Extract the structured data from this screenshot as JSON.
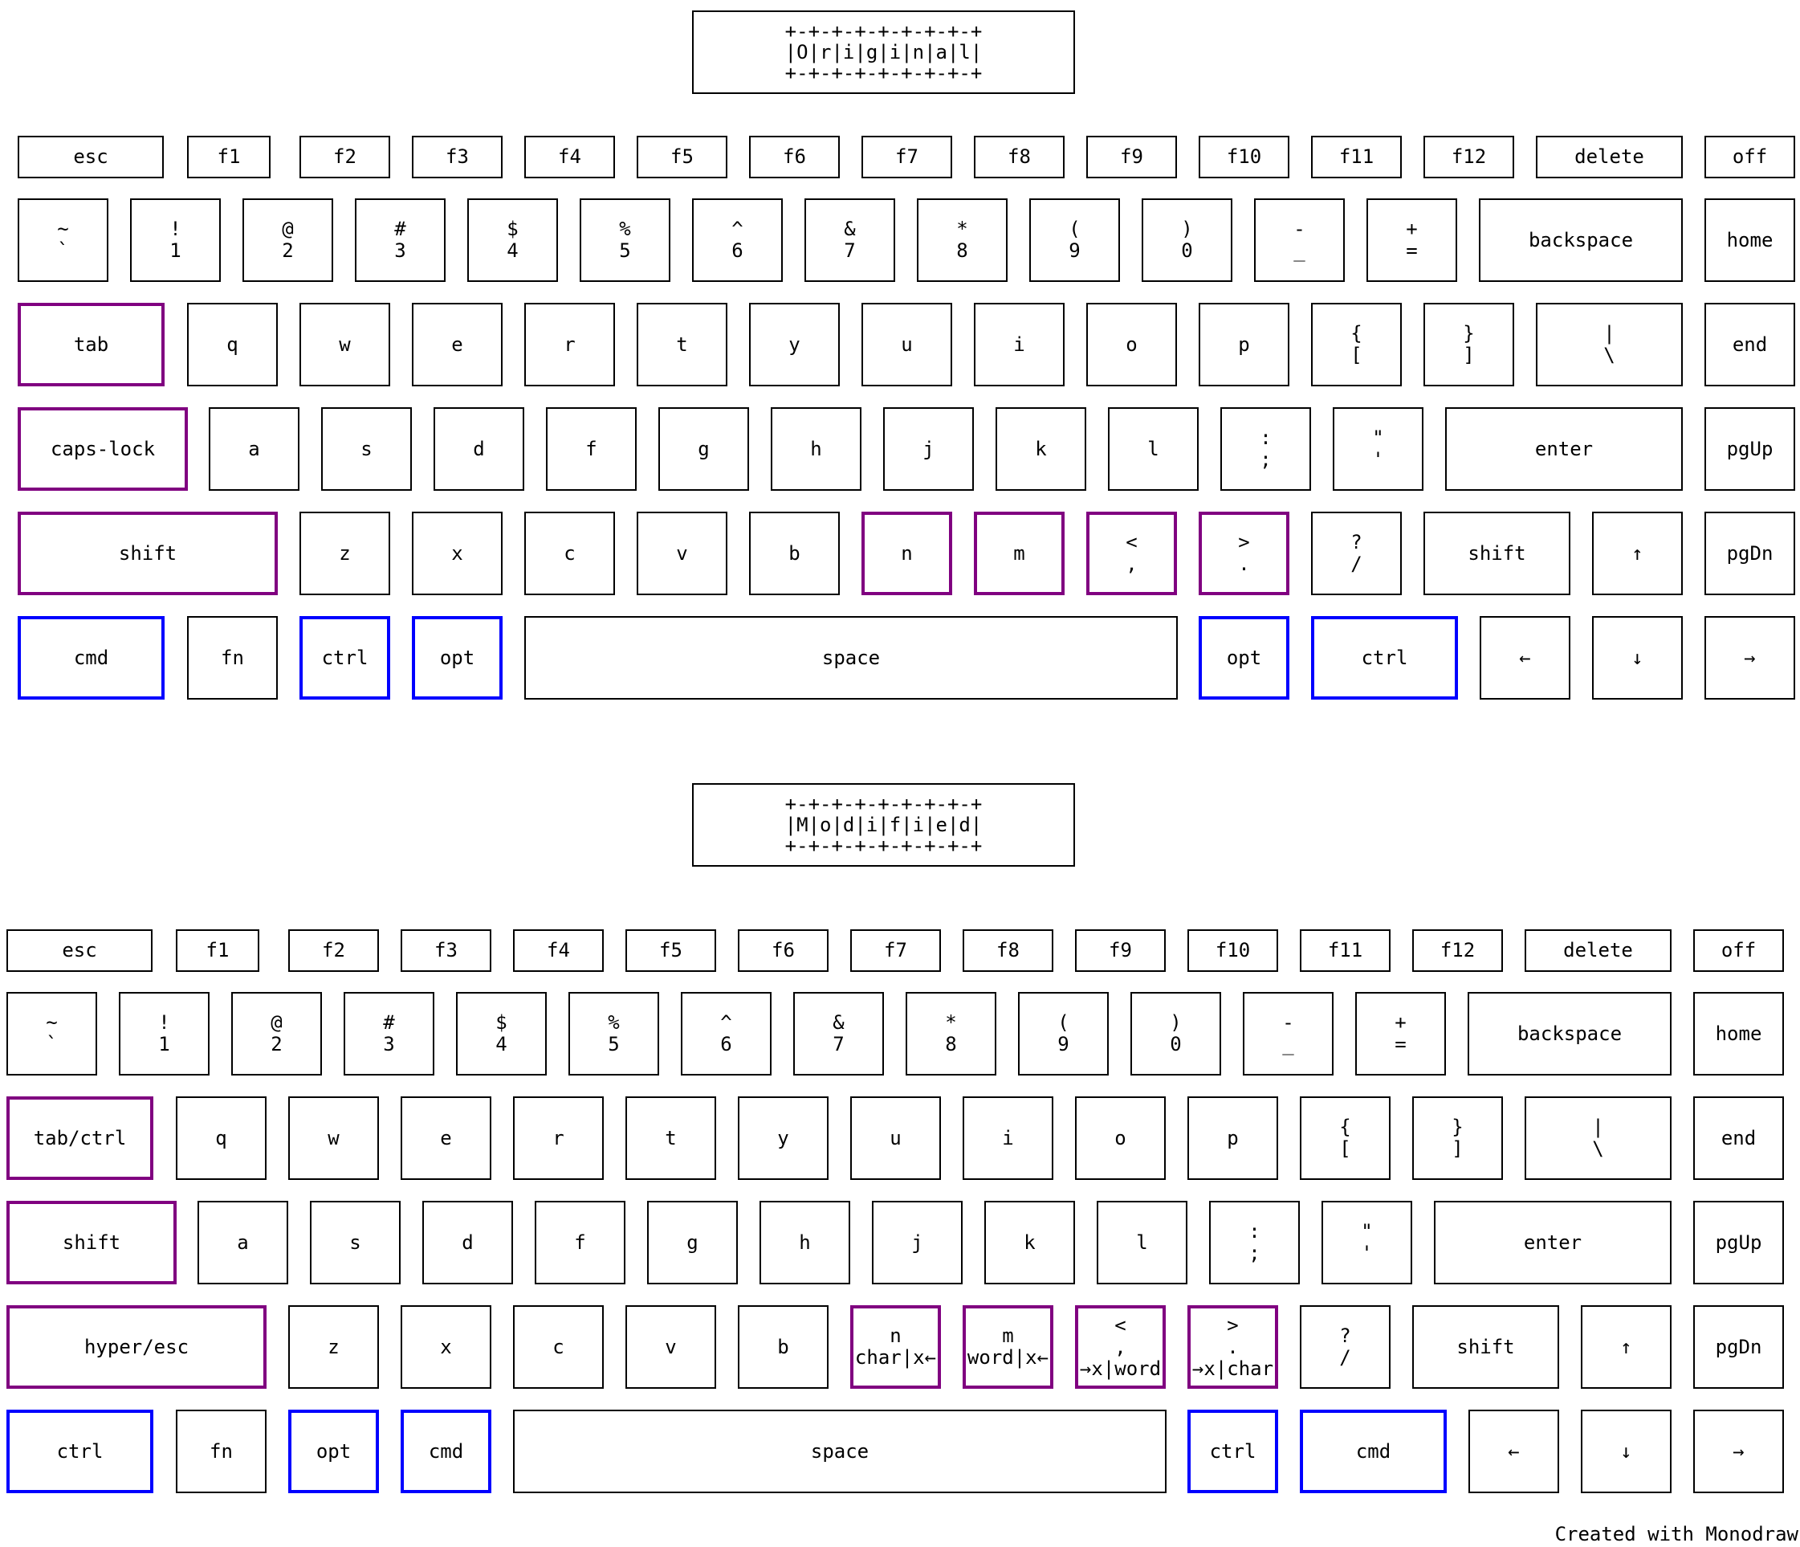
{
  "colors": {
    "border": "#000000",
    "purple": "#800080",
    "blue": "#0000ff"
  },
  "keyboards": [
    {
      "title": [
        "+-+-+-+-+-+-+-+-+",
        "|O|r|i|g|i|n|a|l|",
        "+-+-+-+-+-+-+-+-+"
      ],
      "keys": [
        {
          "l": [
            "esc"
          ]
        },
        {
          "l": [
            "f1"
          ]
        },
        {
          "l": [
            "f2"
          ]
        },
        {
          "l": [
            "f3"
          ]
        },
        {
          "l": [
            "f4"
          ]
        },
        {
          "l": [
            "f5"
          ]
        },
        {
          "l": [
            "f6"
          ]
        },
        {
          "l": [
            "f7"
          ]
        },
        {
          "l": [
            "f8"
          ]
        },
        {
          "l": [
            "f9"
          ]
        },
        {
          "l": [
            "f10"
          ]
        },
        {
          "l": [
            "f11"
          ]
        },
        {
          "l": [
            "f12"
          ]
        },
        {
          "l": [
            "delete"
          ]
        },
        {
          "l": [
            "off"
          ]
        },
        {
          "l": [
            "~",
            "`"
          ]
        },
        {
          "l": [
            "!",
            "1"
          ]
        },
        {
          "l": [
            "@",
            "2"
          ]
        },
        {
          "l": [
            "#",
            "3"
          ]
        },
        {
          "l": [
            "$",
            "4"
          ]
        },
        {
          "l": [
            "%",
            "5"
          ]
        },
        {
          "l": [
            "^",
            "6"
          ]
        },
        {
          "l": [
            "&",
            "7"
          ]
        },
        {
          "l": [
            "*",
            "8"
          ]
        },
        {
          "l": [
            "(",
            "9"
          ]
        },
        {
          "l": [
            ")",
            "0"
          ]
        },
        {
          "l": [
            "-",
            "_"
          ]
        },
        {
          "l": [
            "+",
            "="
          ]
        },
        {
          "l": [
            "backspace"
          ]
        },
        {
          "l": [
            "home"
          ]
        },
        {
          "l": [
            "tab"
          ],
          "c": "purple"
        },
        {
          "l": [
            "q"
          ]
        },
        {
          "l": [
            "w"
          ]
        },
        {
          "l": [
            "e"
          ]
        },
        {
          "l": [
            "r"
          ]
        },
        {
          "l": [
            "t"
          ]
        },
        {
          "l": [
            "y"
          ]
        },
        {
          "l": [
            "u"
          ]
        },
        {
          "l": [
            "i"
          ]
        },
        {
          "l": [
            "o"
          ]
        },
        {
          "l": [
            "p"
          ]
        },
        {
          "l": [
            "{",
            "["
          ]
        },
        {
          "l": [
            "}",
            "]"
          ]
        },
        {
          "l": [
            "|",
            "\\"
          ]
        },
        {
          "l": [
            "end"
          ]
        },
        {
          "l": [
            "caps-lock"
          ],
          "c": "purple"
        },
        {
          "l": [
            "a"
          ]
        },
        {
          "l": [
            "s"
          ]
        },
        {
          "l": [
            "d"
          ]
        },
        {
          "l": [
            "f"
          ]
        },
        {
          "l": [
            "g"
          ]
        },
        {
          "l": [
            "h"
          ]
        },
        {
          "l": [
            "j"
          ]
        },
        {
          "l": [
            "k"
          ]
        },
        {
          "l": [
            "l"
          ]
        },
        {
          "l": [
            ":",
            ";"
          ]
        },
        {
          "l": [
            "\"",
            "'"
          ]
        },
        {
          "l": [
            "enter"
          ]
        },
        {
          "l": [
            "pgUp"
          ]
        },
        {
          "l": [
            "shift"
          ],
          "c": "purple"
        },
        {
          "l": [
            "z"
          ]
        },
        {
          "l": [
            "x"
          ]
        },
        {
          "l": [
            "c"
          ]
        },
        {
          "l": [
            "v"
          ]
        },
        {
          "l": [
            "b"
          ]
        },
        {
          "l": [
            "n"
          ],
          "c": "purple"
        },
        {
          "l": [
            "m"
          ],
          "c": "purple"
        },
        {
          "l": [
            "<",
            ","
          ],
          "c": "purple"
        },
        {
          "l": [
            ">",
            "."
          ],
          "c": "purple"
        },
        {
          "l": [
            "?",
            "/"
          ]
        },
        {
          "l": [
            "shift"
          ]
        },
        {
          "l": [
            "↑"
          ]
        },
        {
          "l": [
            "pgDn"
          ]
        },
        {
          "l": [
            "cmd"
          ],
          "c": "blue"
        },
        {
          "l": [
            "fn"
          ]
        },
        {
          "l": [
            "ctrl"
          ],
          "c": "blue"
        },
        {
          "l": [
            "opt"
          ],
          "c": "blue"
        },
        {
          "l": [
            "space"
          ]
        },
        {
          "l": [
            "opt"
          ],
          "c": "blue"
        },
        {
          "l": [
            "ctrl"
          ],
          "c": "blue"
        },
        {
          "l": [
            "←"
          ]
        },
        {
          "l": [
            "↓"
          ]
        },
        {
          "l": [
            "→"
          ]
        }
      ]
    },
    {
      "title": [
        "+-+-+-+-+-+-+-+-+",
        "|M|o|d|i|f|i|e|d|",
        "+-+-+-+-+-+-+-+-+"
      ],
      "keys": [
        {
          "l": [
            "esc"
          ]
        },
        {
          "l": [
            "f1"
          ]
        },
        {
          "l": [
            "f2"
          ]
        },
        {
          "l": [
            "f3"
          ]
        },
        {
          "l": [
            "f4"
          ]
        },
        {
          "l": [
            "f5"
          ]
        },
        {
          "l": [
            "f6"
          ]
        },
        {
          "l": [
            "f7"
          ]
        },
        {
          "l": [
            "f8"
          ]
        },
        {
          "l": [
            "f9"
          ]
        },
        {
          "l": [
            "f10"
          ]
        },
        {
          "l": [
            "f11"
          ]
        },
        {
          "l": [
            "f12"
          ]
        },
        {
          "l": [
            "delete"
          ]
        },
        {
          "l": [
            "off"
          ]
        },
        {
          "l": [
            "~",
            "`"
          ]
        },
        {
          "l": [
            "!",
            "1"
          ]
        },
        {
          "l": [
            "@",
            "2"
          ]
        },
        {
          "l": [
            "#",
            "3"
          ]
        },
        {
          "l": [
            "$",
            "4"
          ]
        },
        {
          "l": [
            "%",
            "5"
          ]
        },
        {
          "l": [
            "^",
            "6"
          ]
        },
        {
          "l": [
            "&",
            "7"
          ]
        },
        {
          "l": [
            "*",
            "8"
          ]
        },
        {
          "l": [
            "(",
            "9"
          ]
        },
        {
          "l": [
            ")",
            "0"
          ]
        },
        {
          "l": [
            "-",
            "_"
          ]
        },
        {
          "l": [
            "+",
            "="
          ]
        },
        {
          "l": [
            "backspace"
          ]
        },
        {
          "l": [
            "home"
          ]
        },
        {
          "l": [
            "tab/ctrl"
          ],
          "c": "purple"
        },
        {
          "l": [
            "q"
          ]
        },
        {
          "l": [
            "w"
          ]
        },
        {
          "l": [
            "e"
          ]
        },
        {
          "l": [
            "r"
          ]
        },
        {
          "l": [
            "t"
          ]
        },
        {
          "l": [
            "y"
          ]
        },
        {
          "l": [
            "u"
          ]
        },
        {
          "l": [
            "i"
          ]
        },
        {
          "l": [
            "o"
          ]
        },
        {
          "l": [
            "p"
          ]
        },
        {
          "l": [
            "{",
            "["
          ]
        },
        {
          "l": [
            "}",
            "]"
          ]
        },
        {
          "l": [
            "|",
            "\\"
          ]
        },
        {
          "l": [
            "end"
          ]
        },
        {
          "l": [
            "shift"
          ],
          "c": "purple"
        },
        {
          "l": [
            "a"
          ]
        },
        {
          "l": [
            "s"
          ]
        },
        {
          "l": [
            "d"
          ]
        },
        {
          "l": [
            "f"
          ]
        },
        {
          "l": [
            "g"
          ]
        },
        {
          "l": [
            "h"
          ]
        },
        {
          "l": [
            "j"
          ]
        },
        {
          "l": [
            "k"
          ]
        },
        {
          "l": [
            "l"
          ]
        },
        {
          "l": [
            ":",
            ";"
          ]
        },
        {
          "l": [
            "\"",
            "'"
          ]
        },
        {
          "l": [
            "enter"
          ]
        },
        {
          "l": [
            "pgUp"
          ]
        },
        {
          "l": [
            "hyper/esc"
          ],
          "c": "purple"
        },
        {
          "l": [
            "z"
          ]
        },
        {
          "l": [
            "x"
          ]
        },
        {
          "l": [
            "c"
          ]
        },
        {
          "l": [
            "v"
          ]
        },
        {
          "l": [
            "b"
          ]
        },
        {
          "l": [
            "n",
            "char|x←"
          ],
          "c": "purple"
        },
        {
          "l": [
            "m",
            "word|x←"
          ],
          "c": "purple"
        },
        {
          "l": [
            "<",
            ",",
            "→x|word"
          ],
          "c": "purple"
        },
        {
          "l": [
            ">",
            ".",
            "→x|char"
          ],
          "c": "purple"
        },
        {
          "l": [
            "?",
            "/"
          ]
        },
        {
          "l": [
            "shift"
          ]
        },
        {
          "l": [
            "↑"
          ]
        },
        {
          "l": [
            "pgDn"
          ]
        },
        {
          "l": [
            "ctrl"
          ],
          "c": "blue"
        },
        {
          "l": [
            "fn"
          ]
        },
        {
          "l": [
            "opt"
          ],
          "c": "blue"
        },
        {
          "l": [
            "cmd"
          ],
          "c": "blue"
        },
        {
          "l": [
            "space"
          ]
        },
        {
          "l": [
            "ctrl"
          ],
          "c": "blue"
        },
        {
          "l": [
            "cmd"
          ],
          "c": "blue"
        },
        {
          "l": [
            "←"
          ]
        },
        {
          "l": [
            "↓"
          ]
        },
        {
          "l": [
            "→"
          ]
        }
      ]
    }
  ],
  "footer": "Created with Monodraw"
}
